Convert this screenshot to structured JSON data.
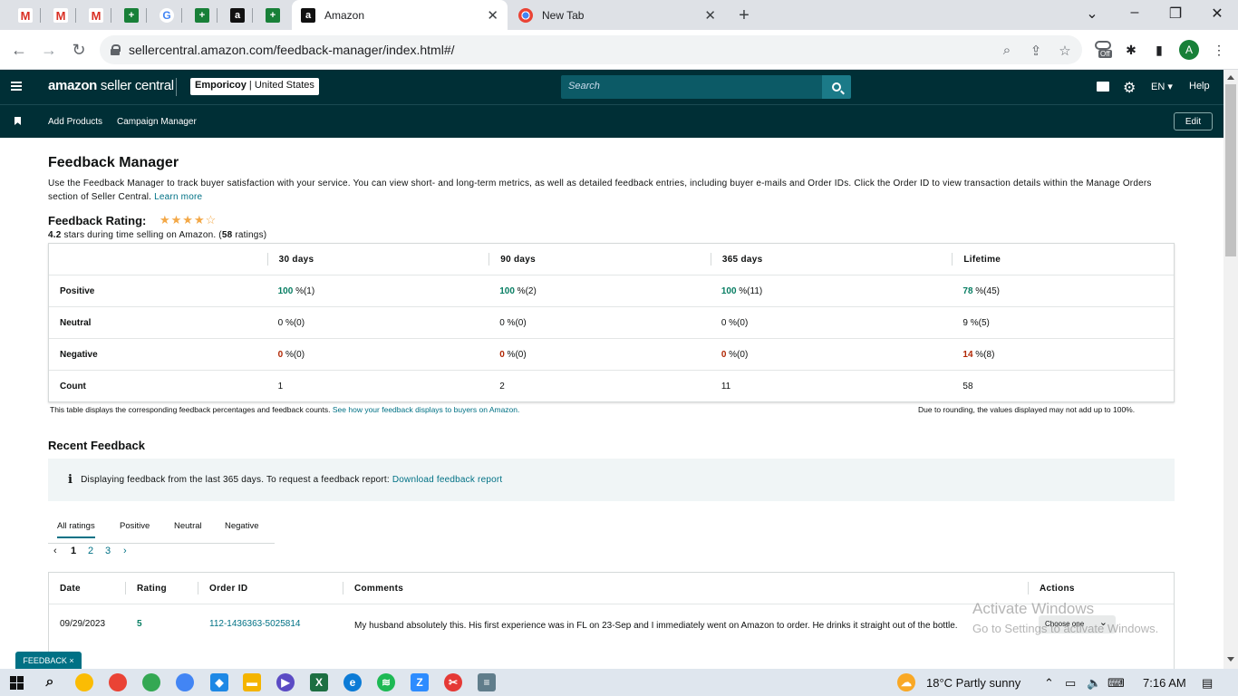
{
  "browser": {
    "tabs": [
      {
        "title": "Amazon",
        "active": true
      },
      {
        "title": "New Tab",
        "active": false
      }
    ],
    "url": "sellercentral.amazon.com/feedback-manager/index.html#/",
    "profile_initial": "A",
    "ext_badge": "Off"
  },
  "header": {
    "logo_brand": "amazon",
    "logo_product": " seller central",
    "account_name": "Emporicoy",
    "account_region": " | United States",
    "search_placeholder": "Search",
    "language": "EN",
    "help": "Help",
    "subnav": [
      "Add Products",
      "Campaign Manager"
    ],
    "edit": "Edit"
  },
  "page": {
    "title": "Feedback Manager",
    "intro": "Use the Feedback Manager to track buyer satisfaction with your service. You can view short- and long-term metrics, as well as detailed feedback entries, including buyer e-mails and Order IDs. Click the Order ID to view transaction details within the Manage Orders section of Seller Central.",
    "learn_more": "Learn more",
    "rating_label": "Feedback Rating:",
    "stars": "★★★★☆",
    "rating_value": "4.2",
    "rating_text": " stars during time selling on Amazon. (",
    "rating_count": "58",
    "rating_suffix": " ratings)"
  },
  "metrics": {
    "columns": [
      "",
      "30 days",
      "90 days",
      "365 days",
      "Lifetime"
    ],
    "rows": [
      {
        "label": "Positive",
        "cells": [
          [
            "100",
            " %(1)"
          ],
          [
            "100",
            " %(2)"
          ],
          [
            "100",
            " %(11)"
          ],
          [
            "78",
            " %(45)"
          ]
        ]
      },
      {
        "label": "Neutral",
        "cells": [
          [
            "0",
            " %(0)"
          ],
          [
            "0",
            " %(0)"
          ],
          [
            "0",
            " %(0)"
          ],
          [
            "9",
            " %(5)"
          ]
        ]
      },
      {
        "label": "Negative",
        "cells": [
          [
            "0",
            " %(0)"
          ],
          [
            "0",
            " %(0)"
          ],
          [
            "0",
            " %(0)"
          ],
          [
            "14",
            " %(8)"
          ]
        ]
      },
      {
        "label": "Count",
        "cells": [
          [
            "1",
            ""
          ],
          [
            "2",
            ""
          ],
          [
            "11",
            ""
          ],
          [
            "58",
            ""
          ]
        ]
      }
    ],
    "note_left": "This table displays the corresponding feedback percentages and feedback counts.",
    "note_link": "See how your feedback displays to buyers on Amazon.",
    "note_right": "Due to rounding, the values displayed may not add up to 100%."
  },
  "recent": {
    "title": "Recent Feedback",
    "info": "Displaying feedback from the last 365 days. To request a feedback report:",
    "info_link": "Download feedback report",
    "tabs": [
      "All ratings",
      "Positive",
      "Neutral",
      "Negative"
    ],
    "pages": [
      "1",
      "2",
      "3"
    ],
    "columns": [
      "Date",
      "Rating",
      "Order ID",
      "Comments",
      "Actions"
    ],
    "rows": [
      {
        "date": "09/29/2023",
        "rating": "5",
        "order_id": "112-1436363-5025814",
        "comment": "My husband absolutely this. His first experience was in FL on 23-Sep and I immediately went on Amazon to order. He drinks it straight out of the bottle.",
        "action": "Choose one"
      }
    ]
  },
  "overlay": {
    "watermark_title": "Activate Windows",
    "watermark_sub": "Go to Settings to activate Windows.",
    "feedback_tab": "FEEDBACK ×"
  },
  "taskbar": {
    "weather": "18°C  Partly sunny",
    "time": "7:16 AM"
  }
}
